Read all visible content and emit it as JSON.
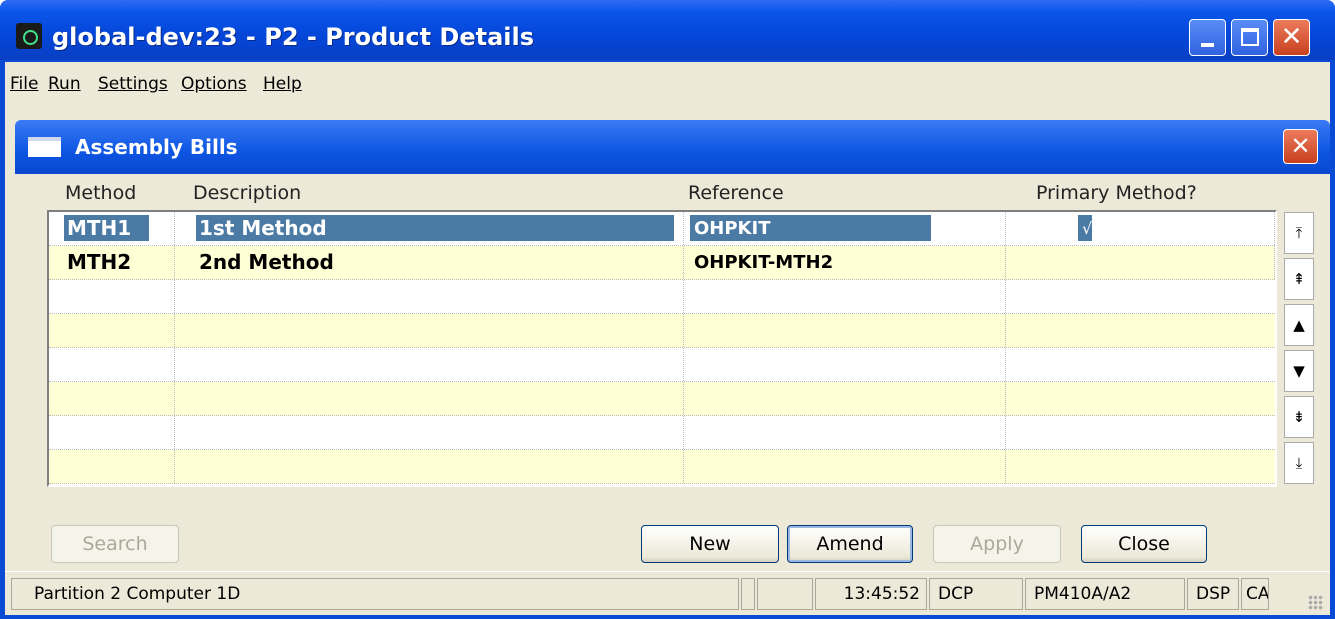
{
  "window": {
    "title": "global-dev:23 - P2 - Product Details",
    "controls": [
      "minimize-icon",
      "maximize-icon",
      "close-icon"
    ]
  },
  "menubar": {
    "items": [
      {
        "label": "File",
        "mnemonic": "F"
      },
      {
        "label": "Run",
        "mnemonic": "R"
      },
      {
        "label": "Settings",
        "mnemonic": "S"
      },
      {
        "label": "Options",
        "mnemonic": "O"
      },
      {
        "label": "Help",
        "mnemonic": "H"
      }
    ]
  },
  "dialog": {
    "title": "Assembly Bills",
    "columns": [
      "Method",
      "Description",
      "Reference",
      "Primary Method?"
    ],
    "rows": [
      {
        "method": "MTH1",
        "description": "1st Method",
        "reference": "OHPKIT",
        "primary": "√",
        "selected": true
      },
      {
        "method": "MTH2",
        "description": "2nd Method",
        "reference": "OHPKIT-MTH2",
        "primary": "",
        "selected": false
      },
      {
        "method": "",
        "description": "",
        "reference": "",
        "primary": ""
      },
      {
        "method": "",
        "description": "",
        "reference": "",
        "primary": ""
      },
      {
        "method": "",
        "description": "",
        "reference": "",
        "primary": ""
      },
      {
        "method": "",
        "description": "",
        "reference": "",
        "primary": ""
      },
      {
        "method": "",
        "description": "",
        "reference": "",
        "primary": ""
      },
      {
        "method": "",
        "description": "",
        "reference": "",
        "primary": ""
      }
    ],
    "scroll_buttons": [
      "scroll-top-icon",
      "page-up-icon",
      "line-up-icon",
      "line-down-icon",
      "page-down-icon",
      "scroll-bottom-icon"
    ],
    "buttons": {
      "search": "Search",
      "new": "New",
      "amend": "Amend",
      "apply": "Apply",
      "close": "Close"
    }
  },
  "statusbar": {
    "partition": "Partition 2 Computer 1D",
    "time": "13:45:52",
    "mode": "DCP",
    "program": "PM410A/A2",
    "dsp": "DSP",
    "extra": "CA"
  },
  "colors": {
    "titlebar": "#0a55e8",
    "selection": "#4b7aa4",
    "alt_row": "#ffffd5",
    "close_button": "#c8401e"
  }
}
